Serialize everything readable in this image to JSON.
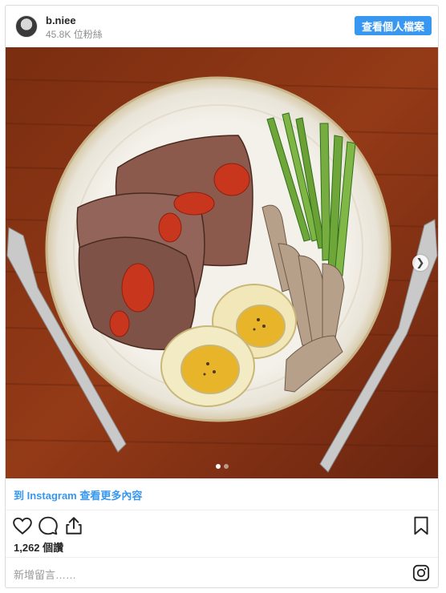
{
  "header": {
    "username": "b.niee",
    "followers": "45.8K 位粉絲",
    "profile_button": "查看個人檔案"
  },
  "photo": {
    "carousel": {
      "current": 1,
      "total": 2
    }
  },
  "view_more_link": "到 Instagram 查看更多內容",
  "likes": "1,262 個讚",
  "comment_placeholder": "新增留言……",
  "icons": {
    "like": "heart-icon",
    "comment": "comment-bubble-icon",
    "share": "share-icon",
    "save": "bookmark-icon",
    "instagram": "instagram-logo-icon",
    "next": "chevron-right-icon"
  },
  "colors": {
    "accent": "#3897f0",
    "text": "#262626",
    "secondary": "#8e8e8e"
  }
}
